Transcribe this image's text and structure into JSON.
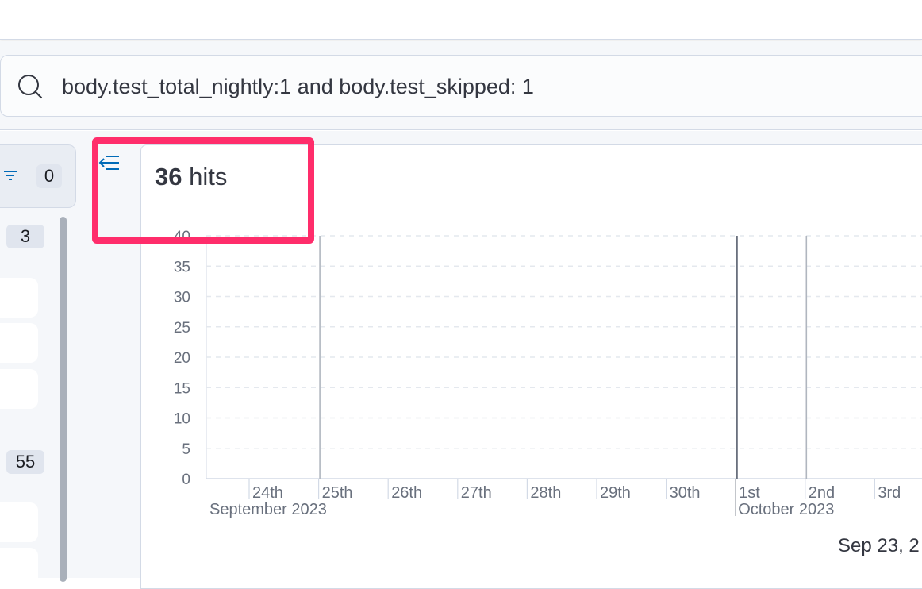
{
  "query": {
    "text": "body.test_total_nightly:1 and body.test_skipped: 1",
    "icon": "search-icon"
  },
  "sidebar": {
    "filter_count": "0",
    "selected_count": "3",
    "available_count": "55",
    "filter_icon": "filter-icon",
    "collapse_icon": "collapse-sidebar-icon"
  },
  "results": {
    "hits_count": "36",
    "hits_label": "hits"
  },
  "chart_data": {
    "type": "bar",
    "title": "",
    "xlabel": "",
    "ylabel": "",
    "ylim": [
      0,
      40
    ],
    "yticks": [
      "0",
      "5",
      "10",
      "15",
      "20",
      "25",
      "30",
      "35",
      "40"
    ],
    "x_ticks": [
      "24th",
      "25th",
      "26th",
      "27th",
      "28th",
      "29th",
      "30th",
      "1st",
      "2nd",
      "3rd"
    ],
    "x_major_labels": [
      "September 2023",
      "October 2023"
    ],
    "grid": true,
    "markers": [
      {
        "x": "25th",
        "style": "light"
      },
      {
        "x": "1st",
        "style": "dark"
      },
      {
        "x": "2nd",
        "style": "light"
      }
    ]
  },
  "footer": {
    "date_range": "Sep 23, 2"
  },
  "colors": {
    "highlight": "#ff2d6b",
    "accent": "#006bb8"
  }
}
